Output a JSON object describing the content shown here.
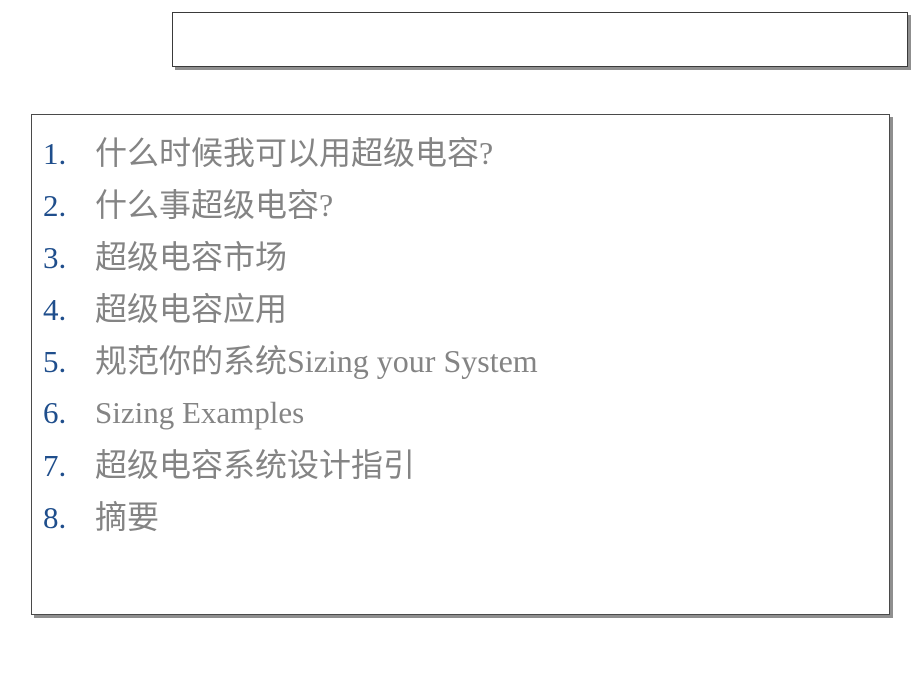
{
  "slide": {
    "background_color": "#ffffff",
    "title": {
      "text": "",
      "placeholder_empty": true,
      "border_color": "#3a3a3a",
      "shadow_color": "#8f8f8f"
    },
    "content": {
      "border_color": "#4a4a4a",
      "shadow_color": "#8f8f8f",
      "number_color": "#1F4E8C",
      "text_color": "#848484",
      "items": [
        {
          "number": "1.",
          "label": "什么时候我可以用超级电容?"
        },
        {
          "number": "2.",
          "label": "什么事超级电容?"
        },
        {
          "number": "3.",
          "label": "超级电容市场"
        },
        {
          "number": "4.",
          "label": "超级电容应用"
        },
        {
          "number": "5.",
          "label": "规范你的系统Sizing your System"
        },
        {
          "number": "6.",
          "label": "Sizing Examples"
        },
        {
          "number": "7.",
          "label": "超级电容系统设计指引"
        },
        {
          "number": "8.",
          "label": "摘要"
        }
      ]
    }
  }
}
